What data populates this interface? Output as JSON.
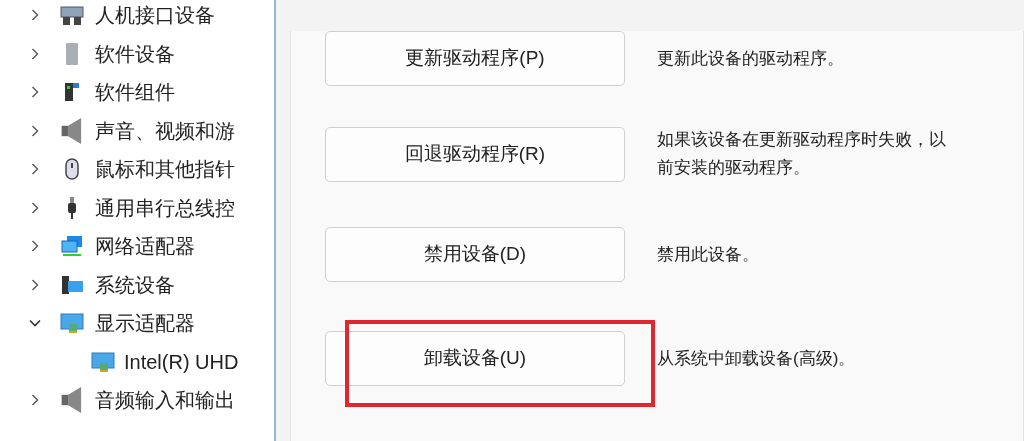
{
  "device_tree": [
    {
      "label": "人机接口设备",
      "expanded": false
    },
    {
      "label": "软件设备",
      "expanded": false
    },
    {
      "label": "软件组件",
      "expanded": false
    },
    {
      "label": "声音、视频和游",
      "expanded": false
    },
    {
      "label": "鼠标和其他指针",
      "expanded": false
    },
    {
      "label": "通用串行总线控",
      "expanded": false
    },
    {
      "label": "网络适配器",
      "expanded": false
    },
    {
      "label": "系统设备",
      "expanded": false
    },
    {
      "label": "显示适配器",
      "expanded": true,
      "children": [
        {
          "label": "Intel(R) UHD"
        }
      ]
    },
    {
      "label": "音频输入和输出",
      "expanded": false
    }
  ],
  "driver_actions": [
    {
      "button": "更新驱动程序(P)",
      "description": "更新此设备的驱动程序。",
      "highlighted": false
    },
    {
      "button": "回退驱动程序(R)",
      "description": "如果该设备在更新驱动程序时失败，以前安装的驱动程序。",
      "highlighted": false
    },
    {
      "button": "禁用设备(D)",
      "description": "禁用此设备。",
      "highlighted": false
    },
    {
      "button": "卸载设备(U)",
      "description": "从系统中卸载设备(高级)。",
      "highlighted": true
    }
  ]
}
